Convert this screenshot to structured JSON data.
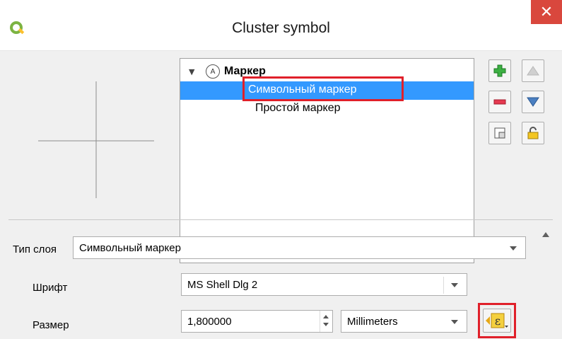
{
  "window": {
    "title": "Cluster symbol",
    "close_glyph": "✕",
    "app_icon": "qgis-logo-icon"
  },
  "tree": {
    "root_label": "Маркер",
    "root_badge": "A",
    "items": [
      {
        "label": "Символьный маркер",
        "selected": true
      },
      {
        "label": "Простой маркер",
        "selected": false
      }
    ]
  },
  "side_buttons": {
    "add": "add-layer-icon",
    "remove": "remove-layer-icon",
    "up": "move-up-icon",
    "down": "move-down-icon",
    "duplicate": "duplicate-layer-icon",
    "lock": "lock-icon"
  },
  "form": {
    "layer_type_label": "Тип слоя",
    "layer_type_value": "Символьный маркер",
    "font_label": "Шрифт",
    "font_value": "MS Shell Dlg 2",
    "size_label": "Размер",
    "size_value": "1,800000",
    "unit_value": "Millimeters",
    "expression_icon": "expression-epsilon-icon"
  },
  "colors": {
    "selection": "#3399ff",
    "highlight_border": "#e0202a",
    "close_bg": "#d9473d"
  }
}
